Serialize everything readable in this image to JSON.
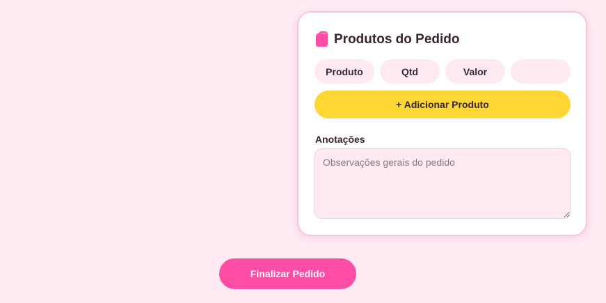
{
  "card": {
    "title": "Produtos do Pedido",
    "icon": "shopping-bag-icon",
    "columns": [
      "Produto",
      "Qtd",
      "Valor",
      ""
    ],
    "add_button_label": "+ Adicionar Produto",
    "notes_label": "Anotações",
    "notes_placeholder": "Observações gerais do pedido",
    "notes_value": ""
  },
  "finish_button_label": "Finalizar Pedido",
  "colors": {
    "background": "#fdeaf3",
    "primary": "#ff4da6",
    "accent": "#ffd633",
    "text": "#3a2430"
  }
}
